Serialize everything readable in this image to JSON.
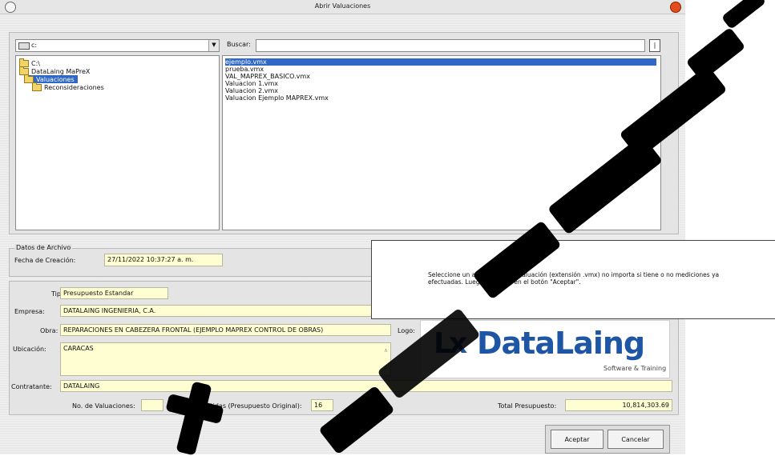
{
  "window": {
    "title": "Abrir Valuaciones"
  },
  "drive": {
    "value": "c:"
  },
  "search": {
    "label": "Buscar:",
    "value": ""
  },
  "tree": {
    "items": [
      {
        "label": "C:\\"
      },
      {
        "label": "DataLaing MaPreX"
      },
      {
        "label": "Valuaciones"
      },
      {
        "label": "Reconsideraciones"
      }
    ]
  },
  "files": {
    "items": [
      "ejemplo.vmx",
      "prueba.vmx",
      "VAL_MAPREX_BASICO.vmx",
      "Valuacion 1.vmx",
      "Valuacion 2.vmx",
      "Valuacion Ejemplo MAPREX.vmx"
    ]
  },
  "archivo": {
    "group_label": "Datos de Archivo",
    "fecha_label": "Fecha de Creación:",
    "fecha_value": "27/11/2022 10:37:27 a. m."
  },
  "info": {
    "tipo_label": "Tipo:",
    "tipo_value": "Presupuesto Estandar",
    "empresa_label": "Empresa:",
    "empresa_value": "DATALAING INGENIERIA, C.A.",
    "obra_label": "Obra:",
    "obra_value": "REPARACIONES EN CABEZERA FRONTAL (EJEMPLO MAPREX CONTROL DE OBRAS)",
    "logo_label": "Logo:",
    "ubicacion_label": "Ubicación:",
    "ubicacion_value": "CARACAS",
    "contratante_label": "Contratante:",
    "contratante_value": "DATALAING",
    "nval_label": "No. de Valuaciones:",
    "nval_value": "",
    "npart_label": "No. Partidas (Presupuesto Original):",
    "npart_value": "16",
    "total_label": "Total Presupuesto:",
    "total_value": "10,814,303.69"
  },
  "logo": {
    "brand": "DataLaing",
    "mark": "Lx",
    "tagline": "Software & Training"
  },
  "tooltip": {
    "text": "Seleccione un archivo de una valuación (extensión .vmx) no importa si tiene o no mediciones ya efectuadas. Luego haga clic en el botón \"Aceptar\"."
  },
  "buttons": {
    "accept": "Aceptar",
    "cancel": "Cancelar"
  },
  "colors": {
    "field_bg": "#fffed2",
    "selection": "#2f68c7",
    "logo_blue": "#1e56a5",
    "logo_red": "#d2232a"
  }
}
